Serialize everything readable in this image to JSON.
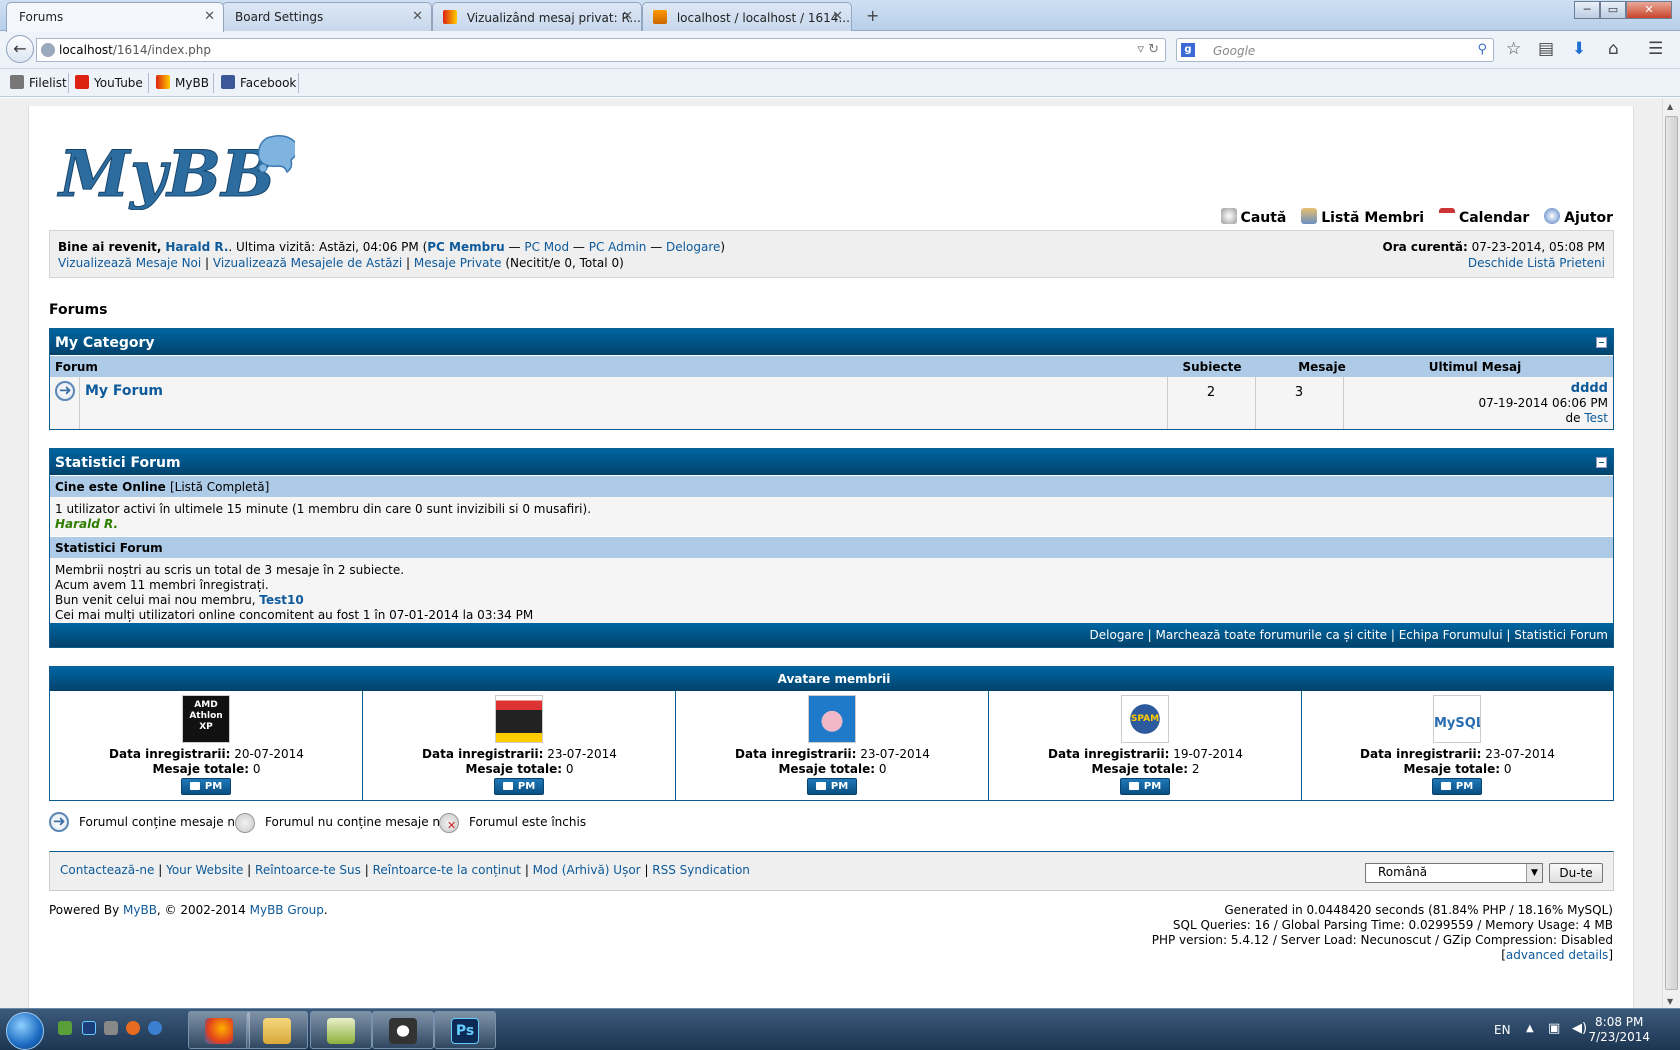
{
  "browser": {
    "tabs": [
      {
        "label": "Forums",
        "active": true
      },
      {
        "label": "Board Settings",
        "active": false
      },
      {
        "label": "Vizualizând mesaj privat: R...",
        "active": false
      },
      {
        "label": "localhost / localhost / 1614...",
        "active": false
      }
    ],
    "new_tab": "+",
    "url_host": "localhost",
    "url_path": "/1614/index.php",
    "search_placeholder": "Google",
    "bookmarks": [
      "Filelist",
      "YouTube",
      "MyBB",
      "Facebook"
    ]
  },
  "logo_text": "MyBB",
  "toplinks": [
    "Caută",
    "Listă Membri",
    "Calendar",
    "Ajutor"
  ],
  "welcome": {
    "greeting": "Bine ai revenit,",
    "username": "Harald R.",
    "last_visit": ". Ultima vizită: Astăzi, 04:06 PM (",
    "pc_member": "PC Membru",
    "pc_mod": "PC Mod",
    "pc_admin": "PC Admin",
    "logout": "Delogare",
    "sep": " — ",
    "close": ")",
    "view_new": "Vizualizează Mesaje Noi",
    "view_today": "Vizualizează Mesajele de Astăzi",
    "private_msgs": "Mesaje Private",
    "pm_status": " (Necitit/e 0, Total 0)",
    "time_label": "Ora curentă:",
    "time_value": " 07-23-2014, 05:08 PM",
    "buddy_list": "Deschide Listă Prieteni"
  },
  "breadcrumb": "Forums",
  "category": {
    "title": "My Category",
    "columns": [
      "Forum",
      "Subiecte",
      "Mesaje",
      "Ultimul Mesaj"
    ],
    "forums": [
      {
        "name": "My Forum",
        "threads": "2",
        "posts": "3",
        "last_subject": "dddd",
        "last_date": "07-19-2014 06:06 PM",
        "last_by_label": "de",
        "last_by": "Test"
      }
    ]
  },
  "stats": {
    "title": "Statistici Forum",
    "online_header": "Cine este Online",
    "online_full_list": "[Listă Completă]",
    "online_text": "1 utilizator activi în ultimele 15 minute (1 membru din care 0 sunt invizibili si 0 musafiri).",
    "online_user": "Harald R.",
    "stats_header": "Statistici Forum",
    "line1": "Membrii noștri au scris un total de 3 mesaje în 2 subiecte.",
    "line2": "Acum avem 11 membri înregistrați.",
    "line3_prefix": "Bun venit celui mai nou membru,",
    "newest_member": "Test10",
    "line4": "Cei mai mulți utilizatori online concomitent au fost 1 în 07-01-2014 la 03:34 PM",
    "footer_links": [
      "Delogare",
      "Marchează toate forumurile ca și citite",
      "Echipa Forumului",
      "Statistici Forum"
    ]
  },
  "avatars": {
    "title": "Avatare membrii",
    "reg_label": "Data inregistrarii:",
    "posts_label": "Mesaje totale:",
    "pm_label": "PM",
    "members": [
      {
        "avatar": "AMD Athlon XP",
        "reg": " 20-07-2014",
        "posts": " 0"
      },
      {
        "avatar": "",
        "reg": " 23-07-2014",
        "posts": " 0"
      },
      {
        "avatar": "",
        "reg": " 23-07-2014",
        "posts": " 0"
      },
      {
        "avatar": "SPAM",
        "reg": " 19-07-2014",
        "posts": " 2"
      },
      {
        "avatar": "MySQL",
        "reg": " 23-07-2014",
        "posts": " 0"
      }
    ]
  },
  "legend": [
    "Forumul conține mesaje noi",
    "Forumul nu conține mesaje noi",
    "Forumul este închis"
  ],
  "footer": {
    "links": [
      "Contactează-ne",
      "Your Website",
      "Reîntoarce-te Sus",
      "Reîntoarce-te la conținut",
      "Mod (Arhivă) Ușor",
      "RSS Syndication"
    ],
    "language": "Română",
    "go": "Du-te",
    "powered_prefix": "Powered By",
    "mybb": "MyBB",
    "copyright": ", © 2002-2014",
    "mybb_group": "MyBB Group",
    "period": ".",
    "debug1": "Generated in 0.0448420 seconds (81.84% PHP / 18.16% MySQL)",
    "debug2": "SQL Queries: 16 / Global Parsing Time: 0.0299559 / Memory Usage: 4 MB",
    "debug3": "PHP version: 5.4.12 / Server Load: Necunoscut / GZip Compression: Disabled",
    "debug4_open": "[",
    "debug4_link": "advanced details",
    "debug4_close": "]"
  },
  "taskbar": {
    "lang": "EN",
    "time": "8:08 PM",
    "date": "7/23/2014"
  },
  "colors": {
    "thead": "#02426c",
    "tcat": "#adcbe7",
    "link": "#0e5a9a",
    "online_user": "#2e7d00"
  }
}
